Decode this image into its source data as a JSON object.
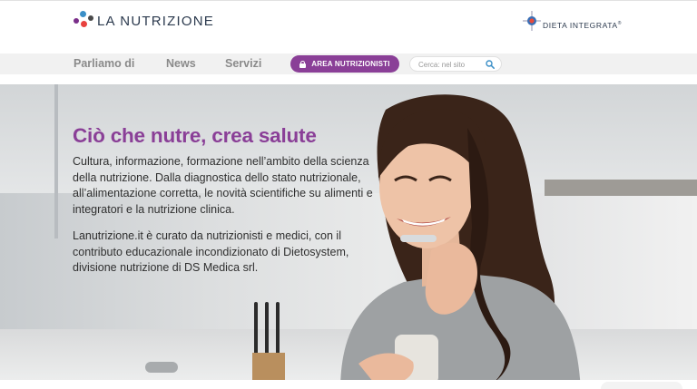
{
  "header": {
    "logo_text": "LA NUTRIZIONE",
    "partner_logo_text": "DIETA INTEGRATA",
    "partner_logo_mark": "®"
  },
  "nav": {
    "items": [
      {
        "label": "Parliamo di"
      },
      {
        "label": "News"
      },
      {
        "label": "Servizi"
      }
    ],
    "area_button_label": "AREA NUTRIZIONISTI",
    "search_placeholder": "Cerca: nel sito"
  },
  "hero": {
    "title": "Ciò che nutre, crea salute",
    "paragraph_1": "Cultura, informazione, formazione nell’ambito della scienza della nutrizione. Dalla diagnostica dello stato nutrizionale, all’alimentazione corretta, le novità scientifiche su alimenti e integratori e la nutrizione clinica.",
    "paragraph_2": "Lanutrizione.it è curato da nutrizionisti e medici, con il contributo educazionale incondizionato di Dietosystem, divisione nutrizione di DS Medica srl."
  },
  "colors": {
    "brand_purple": "#8a3f97",
    "nav_text": "#8a8a8a",
    "body_text": "#2f2f2f",
    "search_icon": "#3b8fc7"
  },
  "icons": {
    "lock": "lock-icon",
    "search": "search-icon"
  }
}
